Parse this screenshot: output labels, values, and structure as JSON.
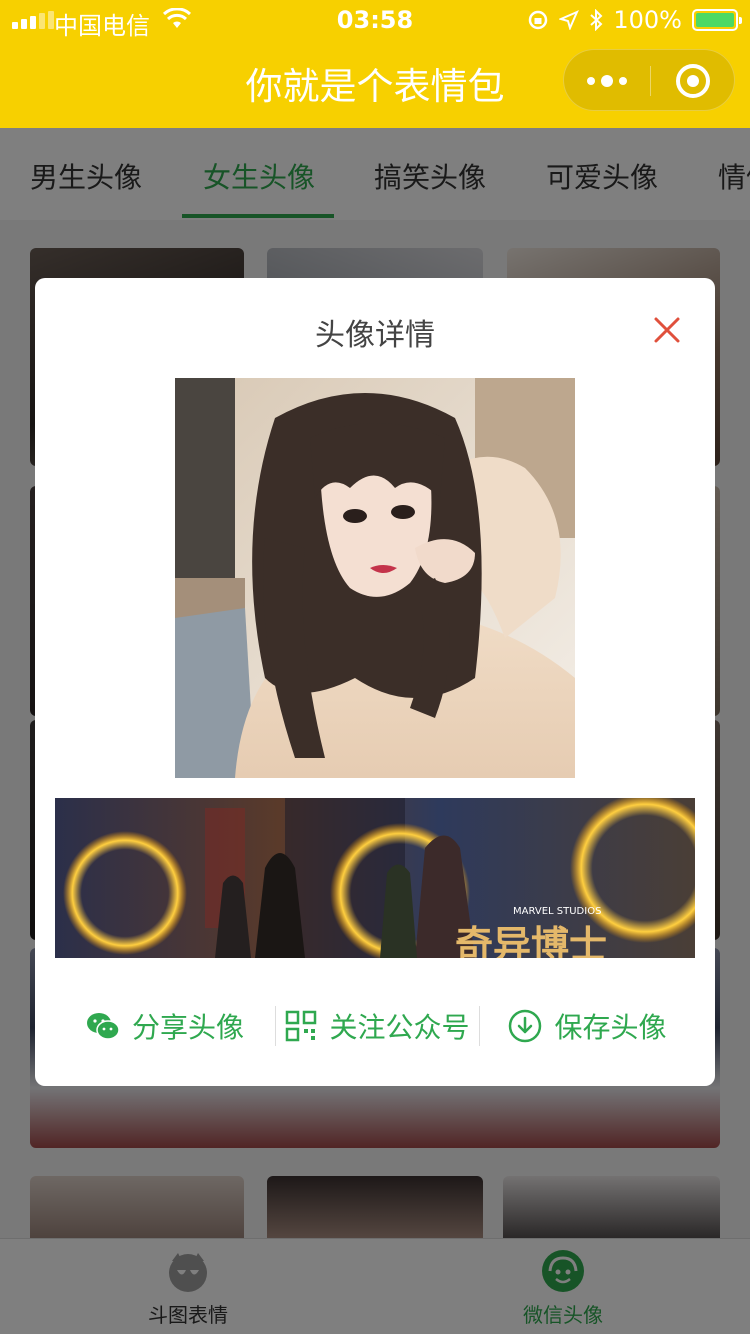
{
  "status_bar": {
    "carrier": "中国电信",
    "time": "03:58",
    "battery": "100%"
  },
  "nav": {
    "title": "你就是个表情包"
  },
  "tabs": [
    {
      "label": "男生头像"
    },
    {
      "label": "女生头像",
      "active": true
    },
    {
      "label": "搞笑头像"
    },
    {
      "label": "可爱头像"
    },
    {
      "label": "情侣头像"
    }
  ],
  "modal": {
    "title": "头像详情",
    "banner_text": "奇异博士",
    "banner_studio": "MARVEL STUDIOS",
    "actions": {
      "share": "分享头像",
      "follow": "关注公众号",
      "save": "保存头像"
    }
  },
  "tabbar": {
    "items": [
      {
        "label": "斗图表情",
        "icon": "meme-face-icon"
      },
      {
        "label": "微信头像",
        "icon": "avatar-face-icon",
        "active": true
      }
    ]
  },
  "colors": {
    "brand_yellow": "#f7d000",
    "accent_green": "#2fa84f",
    "close_red": "#e0503c"
  }
}
